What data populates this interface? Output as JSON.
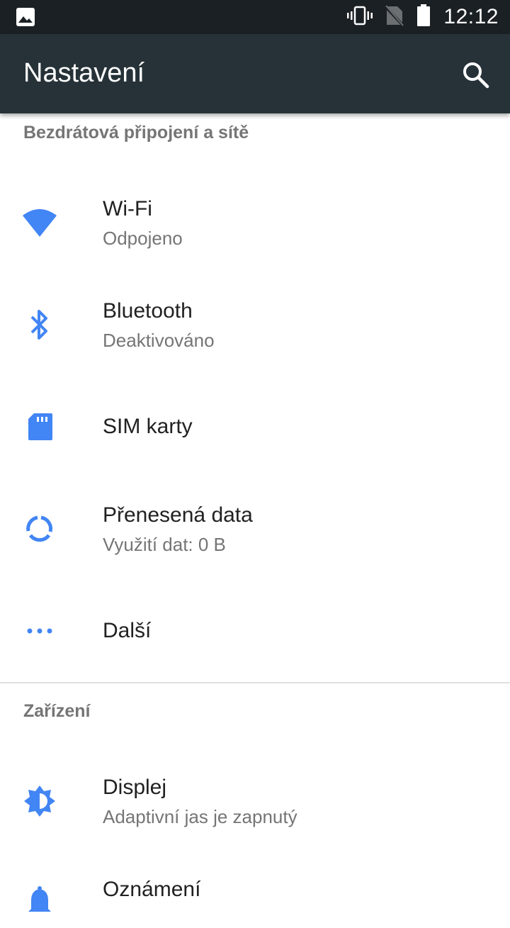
{
  "status_bar": {
    "time": "12:12",
    "icons": [
      "image-notification-icon",
      "vibrate-icon",
      "no-sim-icon",
      "battery-icon"
    ]
  },
  "app_bar": {
    "title": "Nastavení",
    "search_icon": "search-icon"
  },
  "accent_color": "#4285f4",
  "sections": [
    {
      "header": "Bezdrátová připojení a sítě",
      "items": [
        {
          "title": "Wi-Fi",
          "summary": "Odpojeno",
          "icon": "wifi-icon"
        },
        {
          "title": "Bluetooth",
          "summary": "Deaktivováno",
          "icon": "bluetooth-icon"
        },
        {
          "title": "SIM karty",
          "summary": "",
          "icon": "sim-card-icon"
        },
        {
          "title": "Přenesená data",
          "summary": "Využití dat: 0 B",
          "icon": "data-usage-icon"
        },
        {
          "title": "Další",
          "summary": "",
          "icon": "more-icon"
        }
      ]
    },
    {
      "header": "Zařízení",
      "items": [
        {
          "title": "Displej",
          "summary": "Adaptivní jas je zapnutý",
          "icon": "brightness-icon"
        },
        {
          "title": "Oznámení",
          "summary": "",
          "icon": "notifications-icon"
        }
      ]
    }
  ]
}
